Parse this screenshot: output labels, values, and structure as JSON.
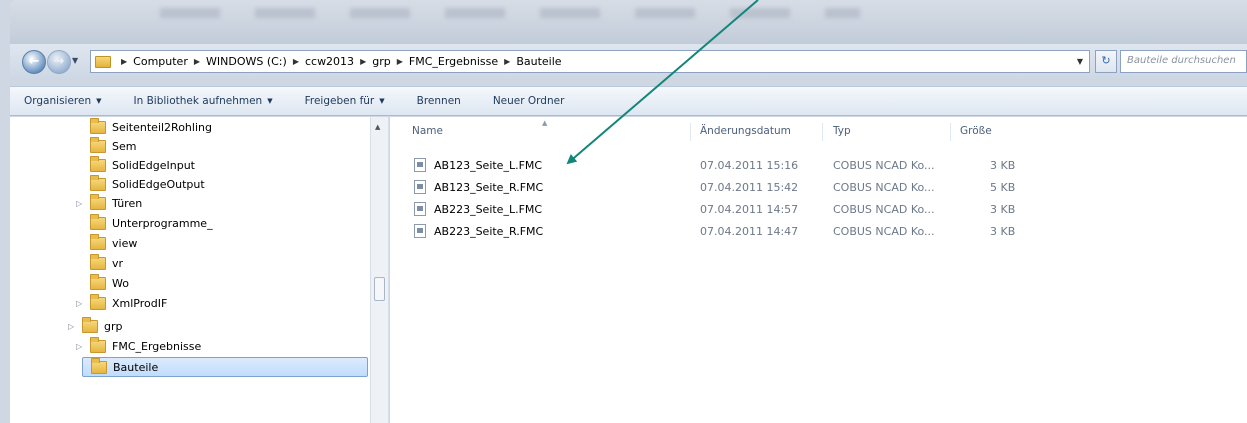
{
  "address_bar": {
    "crumbs": [
      "Computer",
      "WINDOWS (C:)",
      "ccw2013",
      "grp",
      "FMC_Ergebnisse",
      "Bauteile"
    ],
    "search_placeholder": "Bauteile durchsuchen"
  },
  "toolbar": {
    "organize": "Organisieren",
    "include_library": "In Bibliothek aufnehmen",
    "share": "Freigeben für",
    "burn": "Brennen",
    "new_folder": "Neuer Ordner"
  },
  "tree": [
    {
      "label": "Seitenteil2Rohling",
      "expandable": false,
      "selected": false
    },
    {
      "label": "Sem",
      "expandable": false,
      "selected": false
    },
    {
      "label": "SolidEdgeInput",
      "expandable": false,
      "selected": false
    },
    {
      "label": "SolidEdgeOutput",
      "expandable": false,
      "selected": false
    },
    {
      "label": "Türen",
      "expandable": true,
      "selected": false
    },
    {
      "label": "Unterprogramme_",
      "expandable": false,
      "selected": false
    },
    {
      "label": "view",
      "expandable": false,
      "selected": false
    },
    {
      "label": "vr",
      "expandable": false,
      "selected": false
    },
    {
      "label": "Wo",
      "expandable": false,
      "selected": false
    },
    {
      "label": "XmlProdIF",
      "expandable": true,
      "selected": false
    },
    {
      "label": "grp",
      "expandable": true,
      "selected": false
    },
    {
      "label": "FMC_Ergebnisse",
      "expandable": true,
      "selected": false
    },
    {
      "label": "Bauteile",
      "expandable": false,
      "selected": true
    }
  ],
  "columns": {
    "name": "Name",
    "date": "Änderungsdatum",
    "type": "Typ",
    "size": "Größe"
  },
  "files": [
    {
      "name": "AB123_Seite_L.FMC",
      "date": "07.04.2011 15:16",
      "type": "COBUS NCAD Ko...",
      "size": "3 KB"
    },
    {
      "name": "AB123_Seite_R.FMC",
      "date": "07.04.2011 15:42",
      "type": "COBUS NCAD Ko...",
      "size": "5 KB"
    },
    {
      "name": "AB223_Seite_L.FMC",
      "date": "07.04.2011 14:57",
      "type": "COBUS NCAD Ko...",
      "size": "3 KB"
    },
    {
      "name": "AB223_Seite_R.FMC",
      "date": "07.04.2011 14:47",
      "type": "COBUS NCAD Ko...",
      "size": "3 KB"
    }
  ],
  "colors": {
    "annotation_arrow": "#13867a",
    "selection": "#c1dcfc"
  }
}
